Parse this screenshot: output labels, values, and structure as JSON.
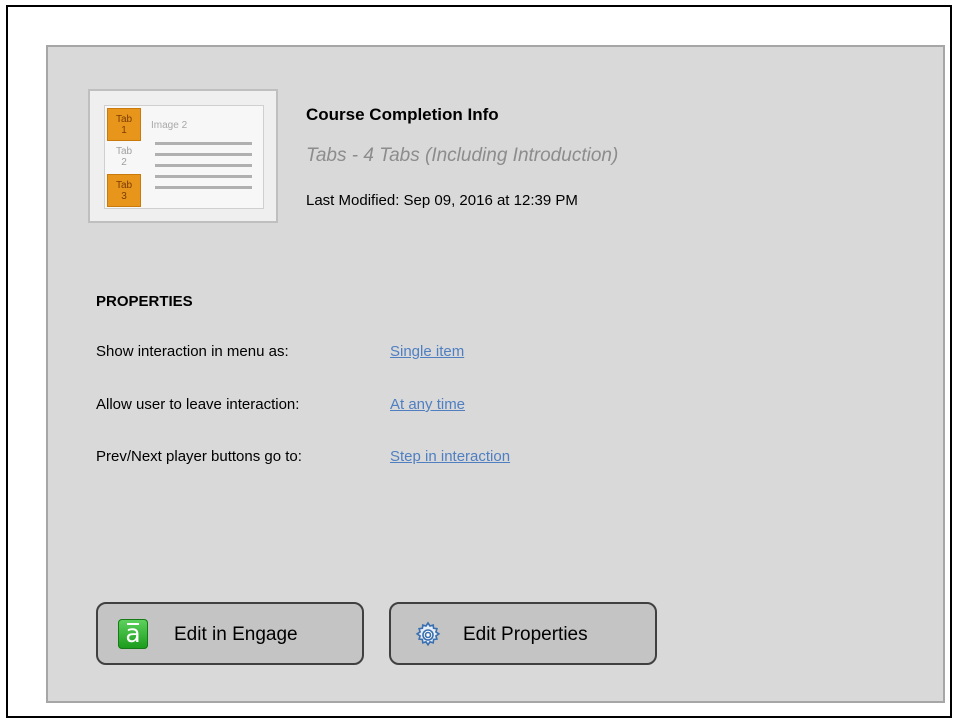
{
  "thumbnail": {
    "tabs": [
      "Tab\n1",
      "Tab\n2",
      "Tab\n3"
    ],
    "image_label": "Image 2"
  },
  "header": {
    "title": "Course Completion Info",
    "subtitle": "Tabs - 4 Tabs (Including Introduction)",
    "last_modified": "Last Modified: Sep 09, 2016 at 12:39 PM"
  },
  "properties": {
    "section_title": "PROPERTIES",
    "items": [
      {
        "label": "Show interaction in menu as:",
        "value": "Single item"
      },
      {
        "label": "Allow user to leave interaction:",
        "value": "At any time"
      },
      {
        "label": "Prev/Next player buttons go to:",
        "value": "Step in interaction"
      }
    ]
  },
  "buttons": {
    "edit_engage": "Edit in Engage",
    "edit_properties": "Edit Properties"
  },
  "icons": {
    "engage": "engage-app-icon",
    "properties": "gear-icon"
  },
  "colors": {
    "panel_bg": "#d9d9d9",
    "link": "#4f7fc1",
    "tab_active": "#e8961b",
    "engage_green": "#2eaa2e"
  }
}
